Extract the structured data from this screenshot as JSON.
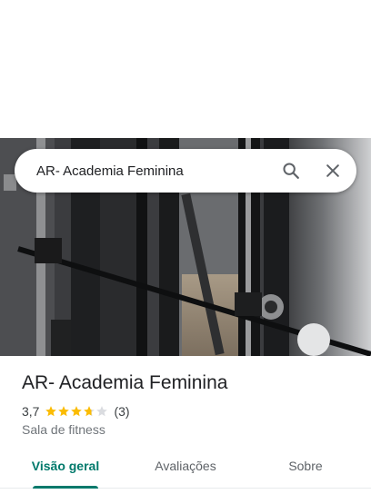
{
  "search": {
    "query": "AR- Academia Feminina"
  },
  "place": {
    "name": "AR- Academia Feminina",
    "rating": "3,7",
    "rating_value": 3.7,
    "rating_max": 5,
    "review_count": "(3)",
    "category": "Sala de fitness"
  },
  "tabs": [
    {
      "label": "Visão geral",
      "active": true
    },
    {
      "label": "Avaliações",
      "active": false
    },
    {
      "label": "Sobre",
      "active": false
    }
  ],
  "colors": {
    "accent": "#00796b",
    "star": "#fbbc04",
    "star_empty": "#dadce0",
    "title": "#202124",
    "secondary": "#70757a"
  },
  "icons": {
    "search": "search-icon",
    "close": "close-icon",
    "star": "star-icon"
  }
}
